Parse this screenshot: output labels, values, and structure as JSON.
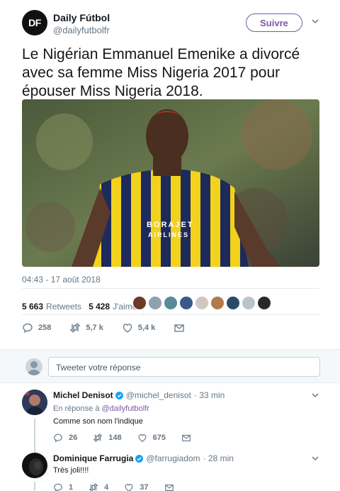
{
  "tweet": {
    "avatar_text": "DF",
    "author_name": "Daily Fútbol",
    "author_handle": "@dailyfutbolfr",
    "follow_label": "Suivre",
    "text": "Le Nigérian Emmanuel Emenike a divorcé avec sa femme Miss Nigeria 2017 pour épouser Miss Nigeria 2018.",
    "photo_text_1": "BORAJET",
    "photo_text_2": "AIRLINES",
    "timestamp": "04:43 - 17 août 2018",
    "retweets_count": "5 663",
    "retweets_label": "Retweets",
    "likes_count": "5 428",
    "likes_label": "J'aime",
    "reply_count": "258",
    "retweet_count_short": "5,7 k",
    "like_count_short": "5,4 k"
  },
  "reply_box": {
    "placeholder": "Tweeter votre réponse"
  },
  "replies": [
    {
      "name": "Michel Denisot",
      "handle": "@michel_denisot",
      "time": "· 33 min",
      "in_reply_prefix": "En réponse à",
      "in_reply_handle": "@dailyfutbolfr",
      "text": "Comme son nom l'indique",
      "reply_count": "26",
      "retweet_count": "148",
      "like_count": "675"
    },
    {
      "name": "Dominique Farrugia",
      "handle": "@farrugiadom",
      "time": "· 28 min",
      "text": "Très joli!!!!",
      "reply_count": "1",
      "retweet_count": "4",
      "like_count": "37"
    }
  ],
  "colors": {
    "accent": "#7b5aa6",
    "muted": "#657786",
    "verified": "#1da1f2"
  }
}
